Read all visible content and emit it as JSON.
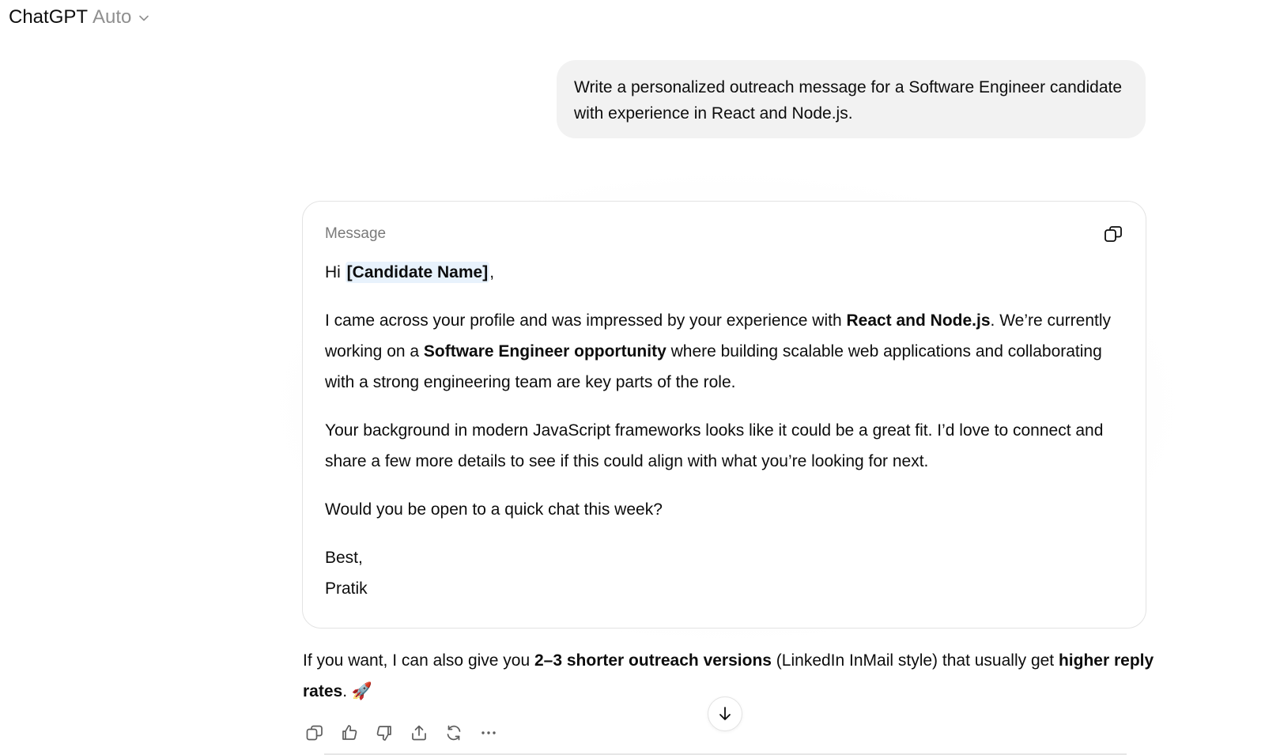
{
  "header": {
    "brand": "ChatGPT",
    "model": "Auto"
  },
  "user_message": {
    "text": "Write a personalized outreach message for a Software Engineer candidate with experience in React and Node.js."
  },
  "assistant": {
    "card": {
      "label": "Message",
      "greeting_prefix": "Hi ",
      "greeting_name": "[Candidate Name]",
      "greeting_suffix": ",",
      "p1": {
        "t1": "I came across your profile and was impressed by your experience with ",
        "b1": "React and Node.js",
        "t2": ". We’re currently working on a ",
        "b2": "Software Engineer opportunity",
        "t3": " where building scalable web applications and collaborating with a strong engineering team are key parts of the role."
      },
      "p2": "Your background in modern JavaScript frameworks looks like it could be a great fit. I’d love to connect and share a few more details to see if this could align with what you’re looking for next.",
      "p3": "Would you be open to a quick chat this week?",
      "signoff": "Best,",
      "signature": "Pratik"
    },
    "followup": {
      "t1": "If you want, I can also give you ",
      "b1": "2–3 shorter outreach versions",
      "t2": " (LinkedIn InMail style) that usually get ",
      "b2": "higher reply rates",
      "t3": ". 🚀"
    }
  },
  "icons": {
    "header_dropdown": "chevron-down-icon",
    "card_copy": "copy-icon",
    "scroll_down": "arrow-down-icon",
    "actions": [
      "copy-icon",
      "thumbs-up-icon",
      "thumbs-down-icon",
      "share-icon",
      "regenerate-icon",
      "more-icon"
    ]
  },
  "colors": {
    "user_bubble": "#f2f2f2",
    "model_label": "#8f8f8f",
    "placeholder_highlight": "#e8f2fc",
    "card_border": "#e3e3e3"
  }
}
